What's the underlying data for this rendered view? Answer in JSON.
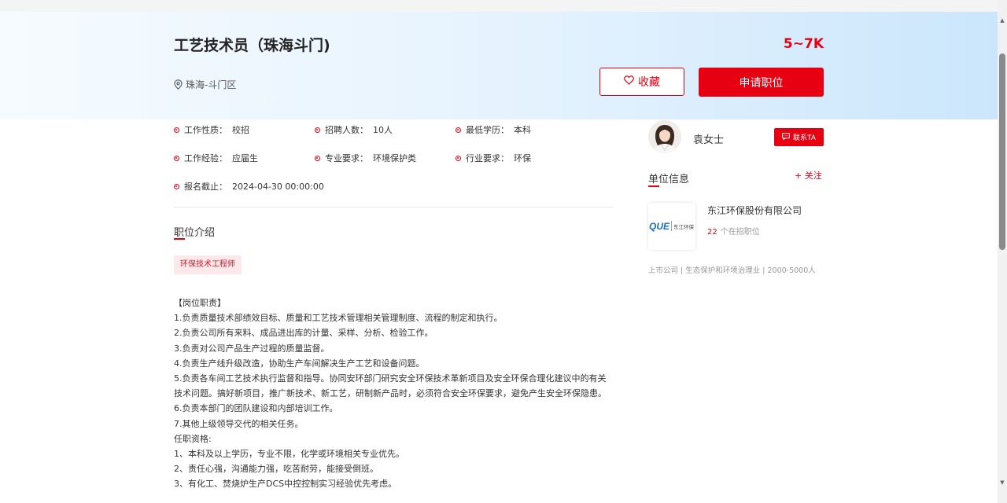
{
  "job": {
    "title": "工艺技术员（珠海斗门)",
    "salary": "5~7K",
    "location": "珠海-斗门区",
    "favorite_label": "收藏",
    "apply_label": "申请职位"
  },
  "attributes": [
    {
      "label": "工作性质：",
      "value": "校招"
    },
    {
      "label": "招聘人数：",
      "value": "10人"
    },
    {
      "label": "最低学历：",
      "value": "本科"
    },
    {
      "label": "工作经验：",
      "value": "应届生"
    },
    {
      "label": "专业要求：",
      "value": "环境保护类"
    },
    {
      "label": "行业要求：",
      "value": "环保"
    },
    {
      "label": "报名截止：",
      "value": "2024-04-30 00:00:00"
    }
  ],
  "intro": {
    "section_title": "职位介绍",
    "tag": "环保技术工程师",
    "lines": [
      "【岗位职责】",
      "1.负责质量技术部绩效目标、质量和工艺技术管理相关管理制度、流程的制定和执行。",
      "2.负责公司所有来料、成品进出库的计量、采样、分析、检验工作。",
      "3.负责对公司产品生产过程的质量监督。",
      "4.负责生产线升级改造，协助生产车间解决生产工艺和设备问题。",
      "5.负责各车间工艺技术执行监督和指导。协同安环部门研究安全环保技术革新项目及安全环保合理化建议中的有关",
      "技术问题。搞好新项目，推广新技术、新工艺，研制新产品时，必须符合安全环保要求，避免产生安全环保隐患。",
      "6.负责本部门的团队建设和内部培训工作。",
      "7.其他上级领导交代的相关任务。",
      "任职资格:",
      "1、本科及以上学历，专业不限，化学或环境相关专业优先。",
      "2、责任心强，沟通能力强，吃苦耐劳，能接受倒班。",
      "3、有化工、焚烧炉生产DCS中控控制实习经验优先考虑。"
    ]
  },
  "contact": {
    "name": "袁女士",
    "button_label": "联系TA"
  },
  "company": {
    "section_title": "单位信息",
    "follow_label": "+ 关注",
    "name": "东江环保股份有限公司",
    "open_jobs_count": "22",
    "open_jobs_label": "个在招职位",
    "meta": "上市公司 | 生态保护和环境治理业 | 2000-5000人",
    "logo_text": "东江环保"
  },
  "colors": {
    "accent": "#e60012",
    "header_gradient_start": "#f6fbff",
    "header_gradient_end": "#cbe6fc"
  }
}
